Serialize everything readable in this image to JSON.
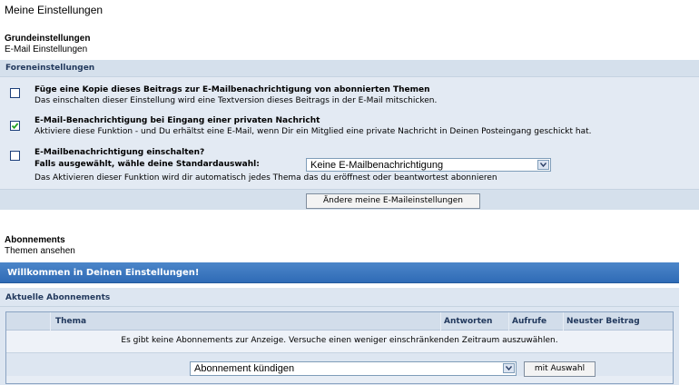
{
  "page_title": "Meine Einstellungen",
  "grund": {
    "title": "Grundeinstellungen",
    "sub": "E-Mail Einstellungen"
  },
  "foren": {
    "header": "Foreneinstellungen",
    "options": [
      {
        "title": "Füge eine Kopie dieses Beitrags zur E-Mailbenachrichtigung von abonnierten Themen",
        "desc": "Das einschalten dieser Einstellung wird eine Textversion dieses Beitrags in der E-Mail mitschicken.",
        "checked": false
      },
      {
        "title": "E-Mail-Benachrichtigung bei Eingang einer privaten Nachricht",
        "desc": "Aktiviere diese Funktion - und Du erhältst eine E-Mail, wenn Dir ein Mitglied eine private Nachricht in Deinen Posteingang geschickt hat.",
        "checked": true
      },
      {
        "title": "E-Mailbenachrichtigung einschalten?",
        "select_label": "Falls ausgewählt, wähle deine Standardauswahl:",
        "select_value": "Keine E-Mailbenachrichtigung",
        "desc": "Das Aktivieren dieser Funktion wird dir automatisch jedes Thema das du eröffnest oder beantwortest abonnieren",
        "checked": false
      }
    ],
    "submit_label": "Ändere meine E-Maileinstellungen"
  },
  "abos": {
    "title": "Abonnements",
    "sub": "Themen ansehen",
    "welcome": "Willkommen in Deinen Einstellungen!",
    "current": "Aktuelle Abonnements",
    "columns": {
      "thema": "Thema",
      "antworten": "Antworten",
      "aufrufe": "Aufrufe",
      "neuster": "Neuster Beitrag"
    },
    "empty_message": "Es gibt keine Abonnements zur Anzeige. Versuche einen weniger einschränkenden Zeitraum auszuwählen.",
    "action_select_value": "Abonnement kündigen",
    "action_button": "mit Auswahl"
  },
  "icons": {
    "checkbox_check": "check-icon",
    "dropdown": "chevron-down-icon"
  },
  "colors": {
    "panel_bg": "#e3eaf3",
    "header_text": "#22395d",
    "blue_bar": "#2f6bb6",
    "checkbox_border": "#1c3f7a",
    "check_mark": "#21a121"
  }
}
